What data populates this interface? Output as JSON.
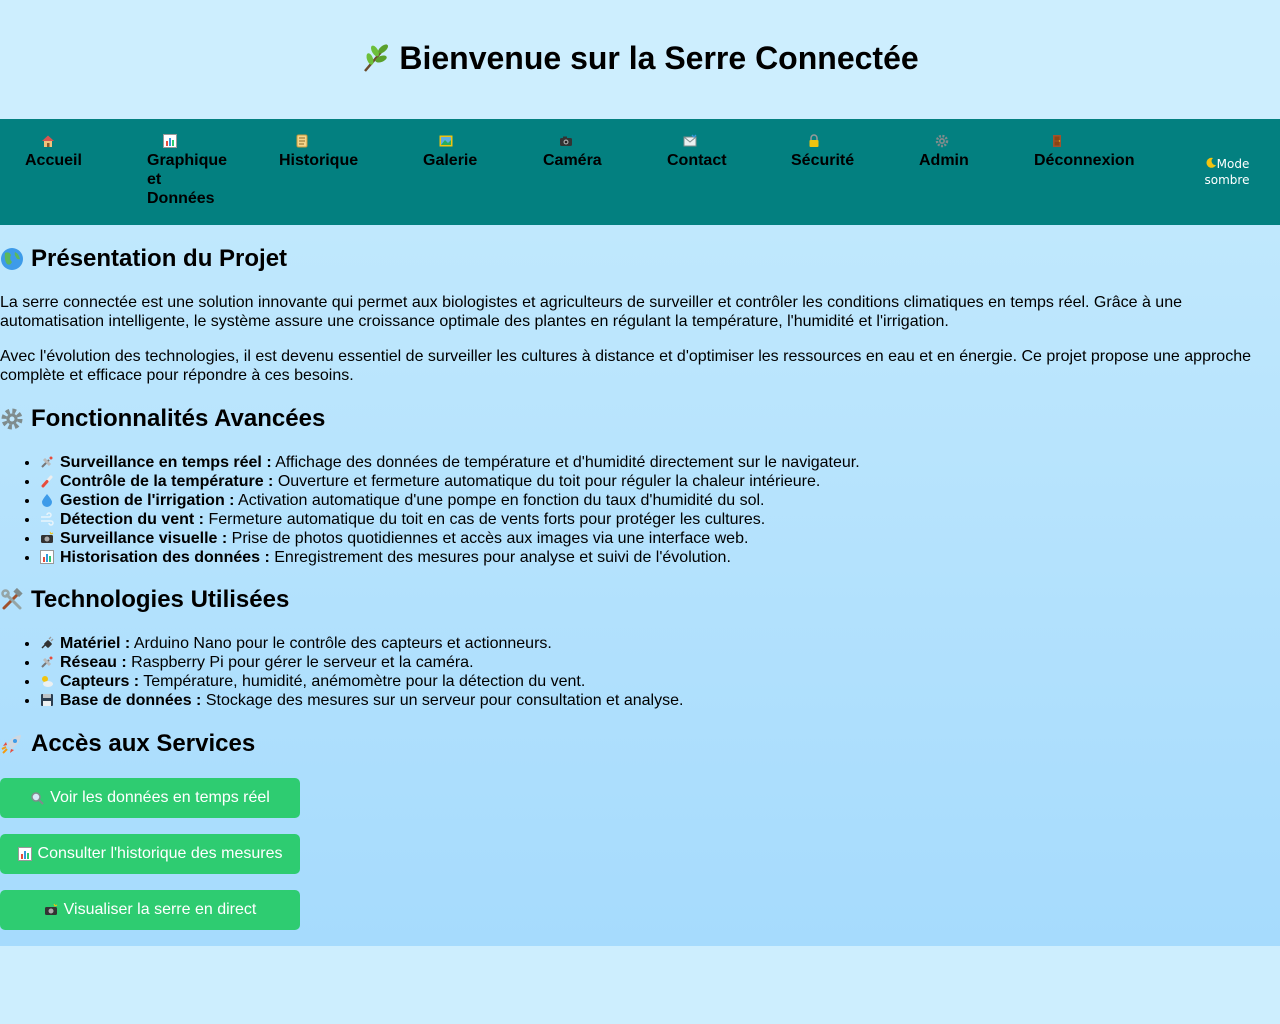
{
  "header": {
    "title": "Bienvenue sur la Serre Connectée",
    "icon": "plant-sprig-icon"
  },
  "nav": {
    "items": [
      {
        "label": "Accueil",
        "icon": "house-icon"
      },
      {
        "label": "Graphique et Données",
        "icon": "bar-chart-icon"
      },
      {
        "label": "Historique",
        "icon": "scroll-icon"
      },
      {
        "label": "Galerie",
        "icon": "picture-icon"
      },
      {
        "label": "Caméra",
        "icon": "camera-icon"
      },
      {
        "label": "Contact",
        "icon": "envelope-icon"
      },
      {
        "label": "Sécurité",
        "icon": "lock-icon"
      },
      {
        "label": "Admin",
        "icon": "gear-icon"
      },
      {
        "label": "Déconnexion",
        "icon": "door-icon"
      }
    ],
    "mode_toggle": {
      "label": "Mode sombre",
      "icon": "moon-icon"
    },
    "background": "#038080"
  },
  "presentation": {
    "title": "Présentation du Projet",
    "icon": "globe-icon",
    "paragraphs": [
      "La serre connectée est une solution innovante qui permet aux biologistes et agriculteurs de surveiller et contrôler les conditions climatiques en temps réel. Grâce à une automatisation intelligente, le système assure une croissance optimale des plantes en régulant la température, l'humidité et l'irrigation.",
      "Avec l'évolution des technologies, il est devenu essentiel de surveiller les cultures à distance et d'optimiser les ressources en eau et en énergie. Ce projet propose une approche complète et efficace pour répondre à ces besoins."
    ]
  },
  "features": {
    "title": "Fonctionnalités Avancées",
    "icon": "gear-icon",
    "items": [
      {
        "icon": "satellite-icon",
        "bold": "Surveillance en temps réel :",
        "text": " Affichage des données de température et d'humidité directement sur le navigateur."
      },
      {
        "icon": "thermometer-icon",
        "bold": "Contrôle de la température :",
        "text": " Ouverture et fermeture automatique du toit pour réguler la chaleur intérieure."
      },
      {
        "icon": "droplet-icon",
        "bold": "Gestion de l'irrigation :",
        "text": " Activation automatique d'une pompe en fonction du taux d'humidité du sol."
      },
      {
        "icon": "wind-icon",
        "bold": "Détection du vent :",
        "text": " Fermeture automatique du toit en cas de vents forts pour protéger les cultures."
      },
      {
        "icon": "camera-flash-icon",
        "bold": "Surveillance visuelle :",
        "text": " Prise de photos quotidiennes et accès aux images via une interface web."
      },
      {
        "icon": "bar-chart-icon",
        "bold": "Historisation des données :",
        "text": " Enregistrement des mesures pour analyse et suivi de l'évolution."
      }
    ]
  },
  "technologies": {
    "title": "Technologies Utilisées",
    "icon": "hammer-wrench-icon",
    "items": [
      {
        "icon": "plug-icon",
        "bold": "Matériel :",
        "text": " Arduino Nano pour le contrôle des capteurs et actionneurs."
      },
      {
        "icon": "satellite-icon",
        "bold": "Réseau :",
        "text": " Raspberry Pi pour gérer le serveur et la caméra."
      },
      {
        "icon": "sun-cloud-icon",
        "bold": "Capteurs :",
        "text": " Température, humidité, anémomètre pour la détection du vent."
      },
      {
        "icon": "floppy-disk-icon",
        "bold": "Base de données :",
        "text": " Stockage des mesures sur un serveur pour consultation et analyse."
      }
    ]
  },
  "services": {
    "title": "Accès aux Services",
    "icon": "rocket-icon",
    "buttons": [
      {
        "label": "Voir les données en temps réel",
        "icon": "magnifier-icon"
      },
      {
        "label": "Consulter l'historique des mesures",
        "icon": "bar-chart-icon"
      },
      {
        "label": "Visualiser la serre en direct",
        "icon": "camera-flash-icon"
      }
    ],
    "button_color": "#2ecc71"
  }
}
